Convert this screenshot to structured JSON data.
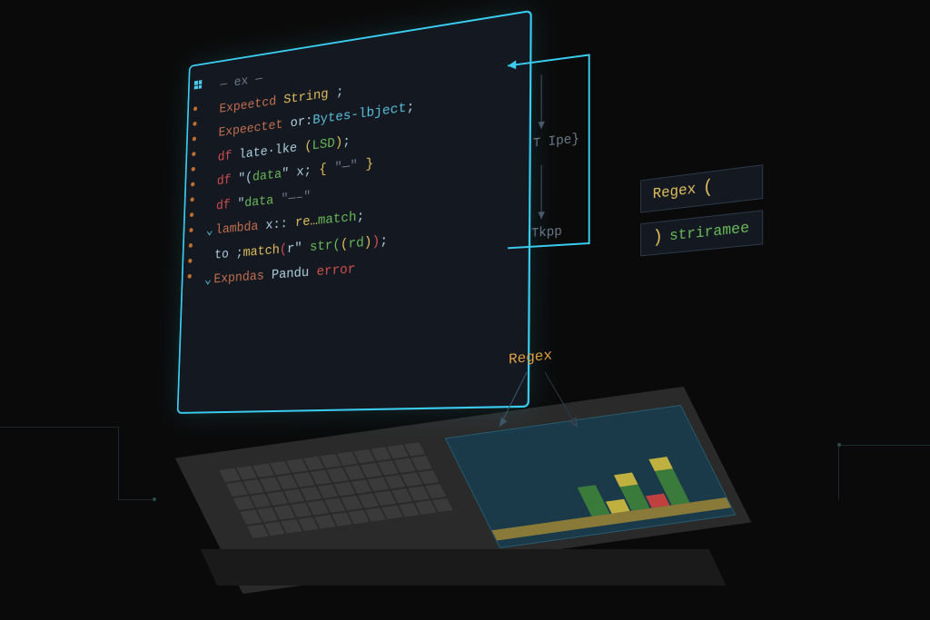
{
  "editor": {
    "lines": [
      {
        "prefix": "—  ex  —",
        "tokens": []
      },
      {
        "tokens": [
          {
            "t": "Expeetcd ",
            "c": "c-kw"
          },
          {
            "t": "String",
            "c": "c-type"
          },
          {
            "t": " ;",
            "c": "c-op"
          }
        ]
      },
      {
        "tokens": [
          {
            "t": "Expeectet ",
            "c": "c-kw"
          },
          {
            "t": "or:",
            "c": "c-op"
          },
          {
            "t": "Bytes-lbject",
            "c": "c-cy"
          },
          {
            "t": ";",
            "c": "c-op"
          }
        ]
      },
      {
        "tokens": [
          {
            "t": "df ",
            "c": "c-red"
          },
          {
            "t": "late·lke ",
            "c": "c-op"
          },
          {
            "t": "(",
            "c": "c-yel"
          },
          {
            "t": "LSD",
            "c": "c-str"
          },
          {
            "t": ")",
            "c": "c-yel"
          },
          {
            "t": ";",
            "c": "c-op"
          }
        ]
      },
      {
        "tokens": [
          {
            "t": "df ",
            "c": "c-red"
          },
          {
            "t": "\"(",
            "c": "c-op"
          },
          {
            "t": "data",
            "c": "c-str"
          },
          {
            "t": "\" x;   ",
            "c": "c-op"
          },
          {
            "t": "{",
            "c": "c-yel"
          },
          {
            "t": " \"—\" ",
            "c": "c-dim"
          },
          {
            "t": "}",
            "c": "c-yel"
          }
        ]
      },
      {
        "tokens": [
          {
            "t": "df ",
            "c": "c-red"
          },
          {
            "t": "\"",
            "c": "c-op"
          },
          {
            "t": "data",
            "c": "c-str"
          },
          {
            "t": "       \"—–\"",
            "c": "c-dim"
          }
        ]
      },
      {
        "chev": true,
        "tokens": [
          {
            "t": "lambda ",
            "c": "c-kw"
          },
          {
            "t": "x:: ",
            "c": "c-op"
          },
          {
            "t": "re…",
            "c": "c-yel"
          },
          {
            "t": "match",
            "c": "c-str"
          },
          {
            "t": ";",
            "c": "c-op"
          }
        ]
      },
      {
        "tokens": [
          {
            "t": "to ;",
            "c": "c-op"
          },
          {
            "t": "match",
            "c": "c-yel"
          },
          {
            "t": "(",
            "c": "c-red"
          },
          {
            "t": "r\" ",
            "c": "c-op"
          },
          {
            "t": "str(",
            "c": "c-str"
          },
          {
            "t": "(",
            "c": "c-yel"
          },
          {
            "t": "rd",
            "c": "c-str"
          },
          {
            "t": ")",
            "c": "c-yel"
          },
          {
            "t": ")",
            "c": "c-red"
          },
          {
            "t": ";",
            "c": "c-op"
          }
        ]
      },
      {
        "chev": true,
        "tokens": [
          {
            "t": "Expndas ",
            "c": "c-kw"
          },
          {
            "t": "Pandu ",
            "c": "c-op"
          },
          {
            "t": "error",
            "c": "c-red"
          }
        ]
      }
    ]
  },
  "flow": {
    "label_top": "⊤ Ipe}",
    "label_bottom": "⊤kpp"
  },
  "tags": {
    "regex": "Regex",
    "striramee": "striramee"
  },
  "float_label": "Regex"
}
